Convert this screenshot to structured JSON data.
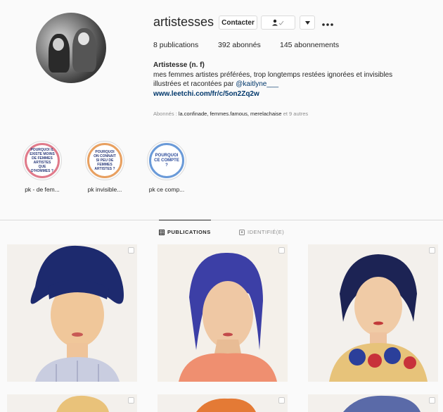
{
  "profile": {
    "username": "artistesses",
    "contact_label": "Contacter",
    "follow_icon": "person-check-icon",
    "dropdown_icon": "caret-down-icon",
    "more_icon": "ellipsis-icon",
    "stats": {
      "posts": "8 publications",
      "followers": "392 abonnés",
      "following": "145 abonnements"
    },
    "bio": {
      "name": "Artistesse (n. f)",
      "line1": "mes femmes artistes préférées, trop longtemps restées ignorées et invisibles",
      "line2_prefix": "illustrées et racontées par ",
      "mention": "@kaitlyne___",
      "link": "www.leetchi.com/fr/c/5on2Zq2w"
    },
    "followed_by_prefix": "Abonnés : ",
    "followed_by_names": "la.confinade, femmes.famous, merelachaise",
    "followed_by_suffix": " et 9 autres"
  },
  "highlights": [
    {
      "label": "pk - de fem...",
      "text": "POURQUOI IL EXISTE MOINS DE FEMMES ARTISTES QUE D'HOMMES ?"
    },
    {
      "label": "pk invisible...",
      "text": "POURQUOI ON CONNAIT SI PEU DE FEMMES ARTISTES ?"
    },
    {
      "label": "pk ce comp...",
      "text": "POURQUOI CE COMPTE ?"
    }
  ],
  "tabs": {
    "publications": "PUBLICATIONS",
    "tagged": "IDENTIFIÉ(E)"
  },
  "colors": {
    "link": "#00376b",
    "muted": "#8e8e8e",
    "border": "#dbdbdb"
  }
}
